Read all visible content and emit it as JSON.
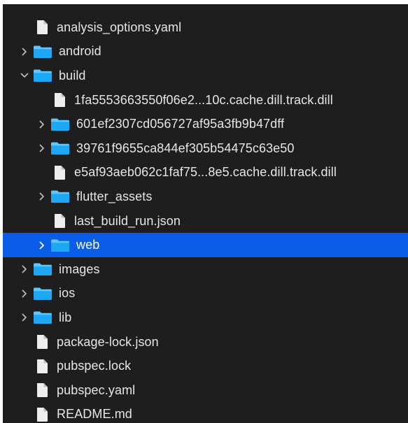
{
  "file_tree": {
    "items": [
      {
        "label": "analysis_options.yaml",
        "type": "file",
        "depth": 0,
        "expandable": false
      },
      {
        "label": "android",
        "type": "folder",
        "depth": 0,
        "expandable": true,
        "expanded": false
      },
      {
        "label": "build",
        "type": "folder",
        "depth": 0,
        "expandable": true,
        "expanded": true
      },
      {
        "label": "1fa5553663550f06e2...10c.cache.dill.track.dill",
        "type": "file",
        "depth": 1,
        "expandable": false
      },
      {
        "label": "601ef2307cd056727af95a3fb9b47dff",
        "type": "folder",
        "depth": 1,
        "expandable": true,
        "expanded": false
      },
      {
        "label": "39761f9655ca844ef305b54475c63e50",
        "type": "folder",
        "depth": 1,
        "expandable": true,
        "expanded": false
      },
      {
        "label": "e5af93aeb062c1faf75...8e5.cache.dill.track.dill",
        "type": "file",
        "depth": 1,
        "expandable": false
      },
      {
        "label": "flutter_assets",
        "type": "folder",
        "depth": 1,
        "expandable": true,
        "expanded": false
      },
      {
        "label": "last_build_run.json",
        "type": "file",
        "depth": 1,
        "expandable": false
      },
      {
        "label": "web",
        "type": "folder",
        "depth": 1,
        "expandable": true,
        "expanded": false,
        "selected": true
      },
      {
        "label": "images",
        "type": "folder",
        "depth": 0,
        "expandable": true,
        "expanded": false
      },
      {
        "label": "ios",
        "type": "folder",
        "depth": 0,
        "expandable": true,
        "expanded": false
      },
      {
        "label": "lib",
        "type": "folder",
        "depth": 0,
        "expandable": true,
        "expanded": false
      },
      {
        "label": "package-lock.json",
        "type": "file",
        "depth": 0,
        "expandable": false
      },
      {
        "label": "pubspec.lock",
        "type": "file",
        "depth": 0,
        "expandable": false
      },
      {
        "label": "pubspec.yaml",
        "type": "file",
        "depth": 0,
        "expandable": false
      },
      {
        "label": "README.md",
        "type": "file",
        "depth": 0,
        "expandable": false
      }
    ]
  },
  "colors": {
    "background": "#1e1e1e",
    "selection": "#0a5de6",
    "folder_body": "#1ea7f5",
    "folder_tab": "#63c6fb",
    "file": "#eeeeee",
    "text": "#e6e6e6"
  },
  "icons": {
    "folder": "folder-icon",
    "file": "document-icon",
    "collapsed": "chevron-right-icon",
    "expanded": "chevron-down-icon"
  }
}
